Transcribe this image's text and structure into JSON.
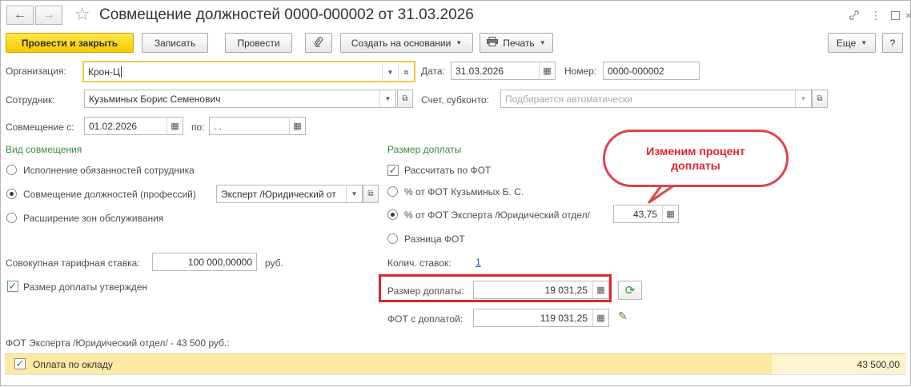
{
  "window": {
    "title": "Совмещение должностей 0000-000002 от 31.03.2026",
    "back_icon": "arrow-left-icon",
    "forward_icon": "arrow-right-icon",
    "favorite_icon": "star-icon"
  },
  "toolbar": {
    "post_close": "Провести и закрыть",
    "save": "Записать",
    "post": "Провести",
    "create_based": "Создать на основании",
    "print": "Печать",
    "more": "Еще",
    "help": "?"
  },
  "form": {
    "organization_label": "Организация:",
    "organization_value": "Крон-Ц",
    "date_label": "Дата:",
    "date_value": "31.03.2026",
    "number_label": "Номер:",
    "number_value": "0000-000002",
    "employee_label": "Сотрудник:",
    "employee_value": "Кузьминых Борис Семенович",
    "account_label": "Счет, субконто:",
    "account_placeholder": "Подбирается автоматически",
    "combine_from_label": "Совмещение с:",
    "combine_from_value": "01.02.2026",
    "combine_to_label": "по:",
    "combine_to_value": " .  .",
    "kind_section": "Вид совмещения",
    "kind_options": [
      "Исполнение обязанностей сотрудника",
      "Совмещение должностей (профессий)",
      "Расширение зон обслуживания"
    ],
    "kind_selected": 1,
    "position_value": "Эксперт /Юридический от",
    "rate_label": "Совокупная тарифная ставка:",
    "rate_value": "100 000,00000",
    "rate_unit": "руб.",
    "approved_label": "Размер доплаты утвержден",
    "approved_checked": true,
    "surcharge_section": "Размер доплаты",
    "calc_by_fot_label": "Рассчитать по ФОТ",
    "calc_by_fot_checked": true,
    "surcharge_options": [
      "% от ФОТ Кузьминых Б. С.",
      "% от ФОТ Эксперта /Юридический отдел/",
      "Разница ФОТ"
    ],
    "surcharge_selected": 1,
    "percent_value": "43,75",
    "rates_count_label": "Колич. ставок:",
    "rates_count_value": "1",
    "surcharge_amount_label": "Размер доплаты:",
    "surcharge_amount_value": "19 031,25",
    "fot_with_label": "ФОТ с доплатой:",
    "fot_with_value": "119 031,25",
    "fot_expert_caption": "ФОТ Эксперта /Юридический отдел/ - 43 500 руб.:"
  },
  "callout": {
    "text_line1": "Изменим процент",
    "text_line2": "доплаты",
    "color": "#e0242c"
  },
  "table": {
    "rows": [
      {
        "name": "Оплата по окладу",
        "checked": true,
        "amount": "43 500,00"
      }
    ]
  },
  "colors": {
    "primary_button": "#f6c800",
    "section_title": "#3b8b3b",
    "row_highlight": "#fbe9a4",
    "link": "#1b5fb0",
    "highlight_box": "#e0242c"
  }
}
